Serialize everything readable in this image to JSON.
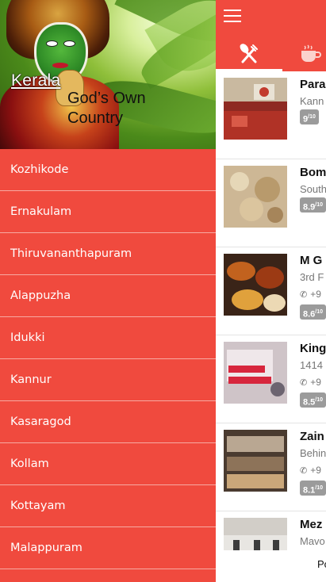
{
  "drawer": {
    "header": {
      "title": "Kerala",
      "tagline": "God’s Own Country"
    },
    "districts": [
      "Kozhikode",
      "Ernakulam",
      "Thiruvananthapuram",
      "Alappuzha",
      "Idukki",
      "Kannur",
      "Kasaragod",
      "Kollam",
      "Kottayam",
      "Malappuram"
    ]
  },
  "main": {
    "tabs": [
      {
        "icon": "fork-knife-icon",
        "selected": true
      },
      {
        "icon": "coffee-cup-icon",
        "selected": false
      }
    ],
    "restaurants": [
      {
        "name": "Para",
        "address": "Kann",
        "phone": "",
        "rating": "9",
        "rating_scale": "/10"
      },
      {
        "name": "Bom",
        "address": "South",
        "phone": "",
        "rating": "8.9",
        "rating_scale": "/10"
      },
      {
        "name": "M G",
        "address": "3rd F",
        "phone": "+9",
        "rating": "8.6",
        "rating_scale": "/10"
      },
      {
        "name": "King",
        "address": "1414",
        "phone": "+9",
        "rating": "8.5",
        "rating_scale": "/10"
      },
      {
        "name": "Zain",
        "address": "Behin",
        "phone": "+9",
        "rating": "8.1",
        "rating_scale": "/10"
      },
      {
        "name": "Mez",
        "address": "Mavo",
        "phone": "+9",
        "rating": "",
        "rating_scale": ""
      }
    ],
    "footer_text": "Po"
  },
  "colors": {
    "primary": "#f04a3e",
    "badge": "#9b9b9b"
  }
}
